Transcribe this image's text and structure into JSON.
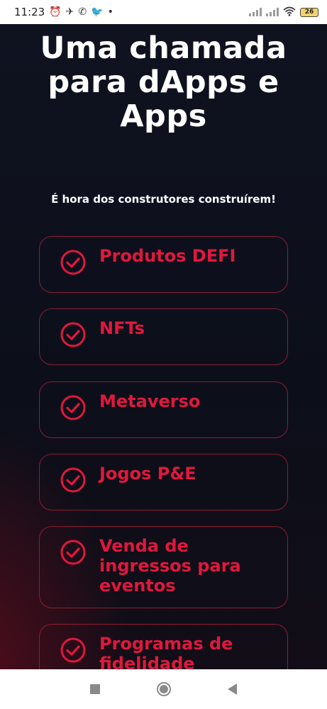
{
  "status_bar": {
    "time": "11:23",
    "battery": "26",
    "left_icons": [
      "alarm-icon",
      "telegram-icon",
      "whatsapp-icon",
      "twitter-icon",
      "dot-icon"
    ],
    "right_icons": [
      "signal-icon",
      "signal-icon",
      "wifi-icon",
      "battery-icon"
    ]
  },
  "hero": {
    "title_line1": "Uma chamada",
    "title_line2": "para dApps e",
    "title_line3": "Apps",
    "subtitle": "É hora dos construtores construírem!"
  },
  "features": [
    {
      "label_lines": [
        "Produtos DEFI"
      ],
      "icon": "check-circle-icon"
    },
    {
      "label_lines": [
        "NFTs"
      ],
      "icon": "check-circle-icon"
    },
    {
      "label_lines": [
        "Metaverso"
      ],
      "icon": "check-circle-icon"
    },
    {
      "label_lines": [
        "Jogos P&E"
      ],
      "icon": "check-circle-icon"
    },
    {
      "label_lines": [
        "Venda de",
        "ingressos para",
        "eventos"
      ],
      "icon": "check-circle-icon"
    },
    {
      "label_lines": [
        "Programas de",
        "fidelidade"
      ],
      "icon": "check-circle-icon"
    }
  ],
  "nav_bar": {
    "buttons": [
      "recents-button",
      "home-button",
      "back-button"
    ]
  },
  "colors": {
    "background": "#0d0f19",
    "accent": "#e0183c",
    "card_border": "#8c1d30",
    "title": "#ffffff"
  }
}
